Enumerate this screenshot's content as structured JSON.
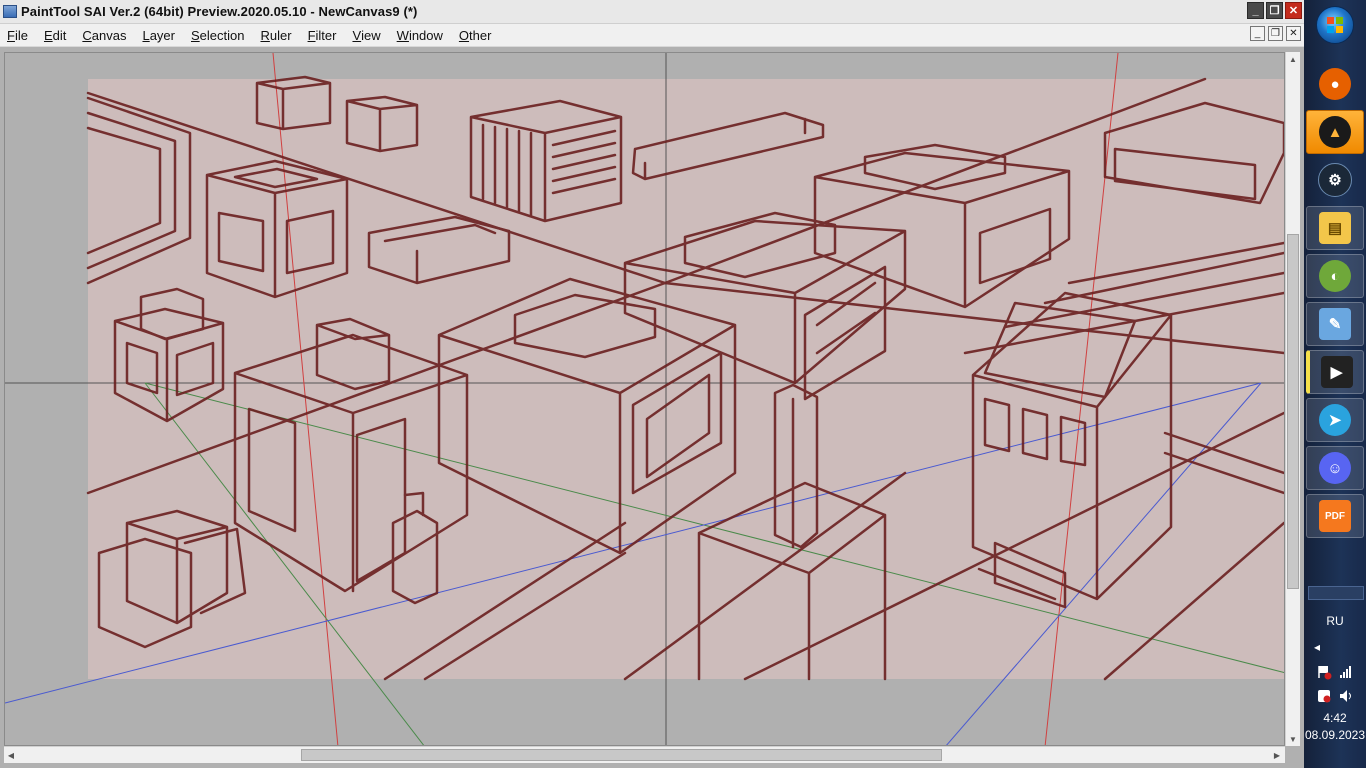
{
  "window": {
    "title": "PaintTool SAI Ver.2 (64bit) Preview.2020.05.10 - NewCanvas9 (*)",
    "minimize_glyph": "_",
    "maximize_glyph": "❐",
    "close_glyph": "✕"
  },
  "menu": [
    {
      "u": "F",
      "rest": "ile"
    },
    {
      "u": "E",
      "rest": "dit"
    },
    {
      "u": "C",
      "rest": "anvas"
    },
    {
      "u": "L",
      "rest": "ayer"
    },
    {
      "u": "S",
      "rest": "election"
    },
    {
      "u": "R",
      "rest": "uler"
    },
    {
      "u": "F",
      "rest": "ilter"
    },
    {
      "u": "V",
      "rest": "iew"
    },
    {
      "u": "W",
      "rest": "indow"
    },
    {
      "u": "O",
      "rest": "ther"
    }
  ],
  "mdi": {
    "minimize_glyph": "_",
    "restore_glyph": "❐",
    "close_glyph": "✕"
  },
  "scroll": {
    "up": "▲",
    "down": "▼",
    "left": "◀",
    "right": "▶"
  },
  "taskbar": {
    "apps": [
      {
        "name": "firefox-icon",
        "color": "#e66000",
        "glyph": "●"
      },
      {
        "name": "artrage-icon",
        "color": "#1a1a1a",
        "glyph": "▲"
      },
      {
        "name": "steam-icon",
        "color": "#1b2838",
        "glyph": "⚙"
      },
      {
        "name": "file-explorer-icon",
        "color": "#f3c64a",
        "glyph": "▤"
      },
      {
        "name": "melon-icon",
        "color": "#6fa83a",
        "glyph": "◐"
      },
      {
        "name": "notepad-icon",
        "color": "#6aa7e0",
        "glyph": "✎"
      },
      {
        "name": "media-player-icon",
        "color": "#222222",
        "glyph": "▶"
      },
      {
        "name": "telegram-icon",
        "color": "#2aa3de",
        "glyph": "➤"
      },
      {
        "name": "discord-icon",
        "color": "#5865f2",
        "glyph": "☺"
      },
      {
        "name": "pdf-reader-icon",
        "color": "#f5781e",
        "glyph": "PDF"
      }
    ],
    "language": "RU",
    "tray_arrow": "◂",
    "time": "4:42",
    "date": "08.09.2023"
  }
}
